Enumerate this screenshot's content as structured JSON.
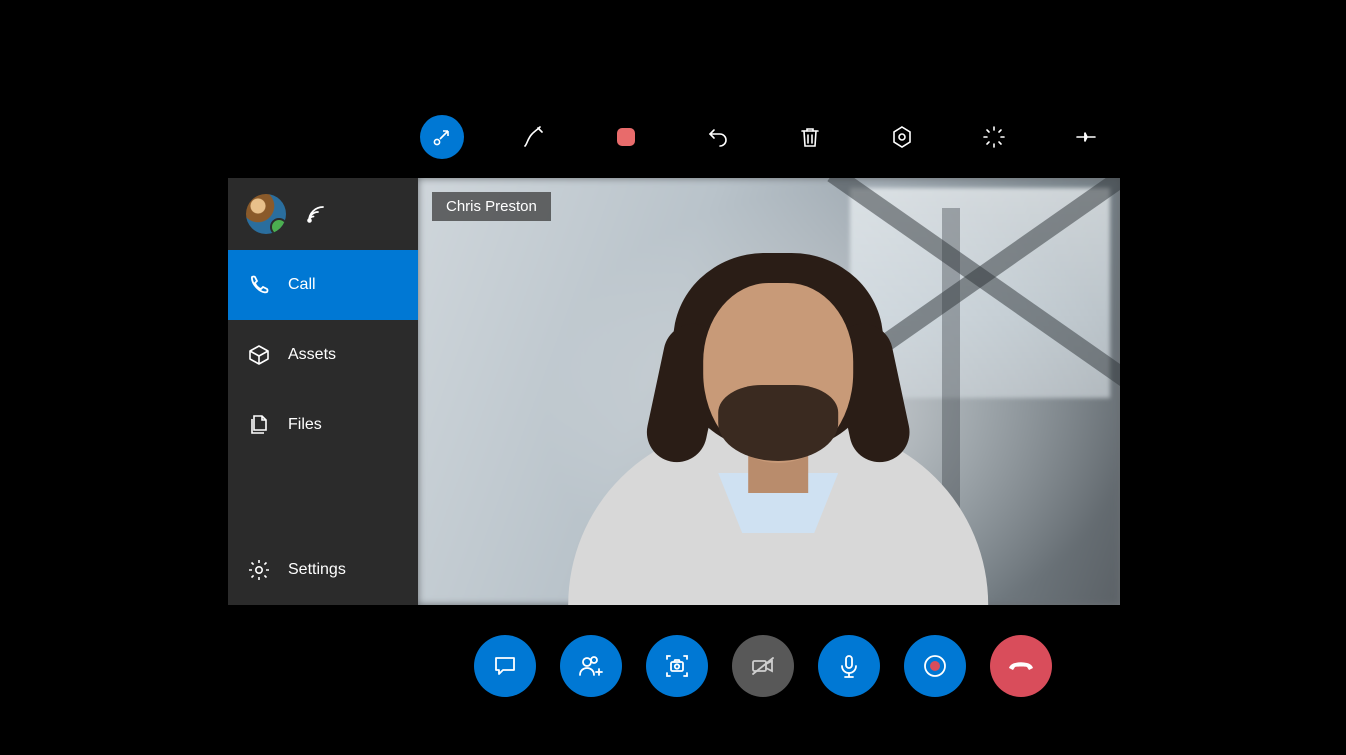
{
  "colors": {
    "accent": "#0078D4",
    "danger": "#D94D5B",
    "muted": "#585858",
    "sidebar": "#2b2b2b",
    "record_square": "#E86B6B",
    "presence_online": "#4CAF50"
  },
  "toolbar": {
    "items": [
      {
        "name": "collapse-arrow",
        "icon": "arrow-in"
      },
      {
        "name": "annotate-pen",
        "icon": "pen"
      },
      {
        "name": "color-select",
        "icon": "square"
      },
      {
        "name": "undo",
        "icon": "undo"
      },
      {
        "name": "delete",
        "icon": "trash"
      },
      {
        "name": "hololens-marker",
        "icon": "hexagon"
      },
      {
        "name": "expand",
        "icon": "expand"
      },
      {
        "name": "pin",
        "icon": "pin"
      }
    ]
  },
  "sidebar": {
    "presence": "online",
    "items": [
      {
        "label": "Call",
        "icon": "phone",
        "active": true
      },
      {
        "label": "Assets",
        "icon": "box"
      },
      {
        "label": "Files",
        "icon": "files"
      }
    ],
    "footer": {
      "label": "Settings",
      "icon": "gear"
    }
  },
  "video": {
    "participant_name": "Chris Preston"
  },
  "call_controls": [
    {
      "name": "chat",
      "icon": "chat",
      "color": "blue"
    },
    {
      "name": "add-participant",
      "icon": "add-person",
      "color": "blue"
    },
    {
      "name": "screenshot",
      "icon": "camera-frame",
      "color": "blue"
    },
    {
      "name": "camera-off",
      "icon": "camera-off",
      "color": "grey"
    },
    {
      "name": "microphone",
      "icon": "mic",
      "color": "blue"
    },
    {
      "name": "record",
      "icon": "record",
      "color": "blue"
    },
    {
      "name": "end-call",
      "icon": "hangup",
      "color": "red"
    }
  ]
}
